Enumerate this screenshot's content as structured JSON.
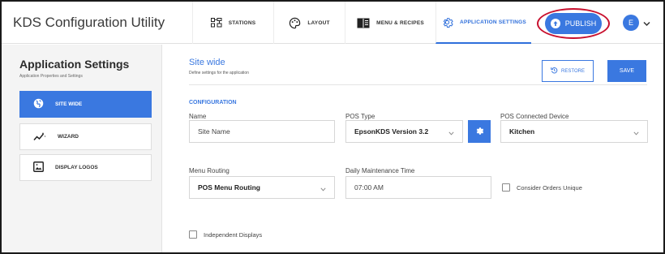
{
  "app": {
    "title": "KDS Configuration Utility"
  },
  "nav": {
    "tabs": [
      {
        "label": "STATIONS",
        "icon": "stations-icon"
      },
      {
        "label": "LAYOUT",
        "icon": "palette-icon"
      },
      {
        "label": "MENU & RECIPES",
        "icon": "book-icon"
      },
      {
        "label": "APPLICATION SETTINGS",
        "icon": "gear-icon",
        "active": true
      }
    ],
    "publish_label": "PUBLISH",
    "avatar_initial": "E"
  },
  "sidebar": {
    "title": "Application Settings",
    "subtitle": "Application Properties and Settings",
    "items": [
      {
        "label": "SITE WIDE",
        "icon": "globe-icon",
        "active": true
      },
      {
        "label": "WIZARD",
        "icon": "wand-icon"
      },
      {
        "label": "DISPLAY LOGOS",
        "icon": "image-icon"
      }
    ]
  },
  "main": {
    "section_title": "Site wide",
    "section_subtitle": "Define settings for the application",
    "restore_label": "RESTORE",
    "save_label": "SAVE",
    "config_title": "CONFIGURATION",
    "name": {
      "label": "Name",
      "value": "Site Name"
    },
    "pos_type": {
      "label": "POS Type",
      "value": "EpsonKDS Version 3.2"
    },
    "pos_device": {
      "label": "POS Connected Device",
      "value": "Kitchen"
    },
    "menu_routing": {
      "label": "Menu Routing",
      "value": "POS Menu Routing"
    },
    "maintenance": {
      "label": "Daily Maintenance Time",
      "value": "07:00 AM"
    },
    "unique_orders": {
      "label": "Consider Orders Unique",
      "checked": false
    },
    "independent": {
      "label": "Independent Displays",
      "checked": false
    }
  },
  "colors": {
    "accent": "#3a78e0",
    "highlight_ring": "#c8102e"
  }
}
